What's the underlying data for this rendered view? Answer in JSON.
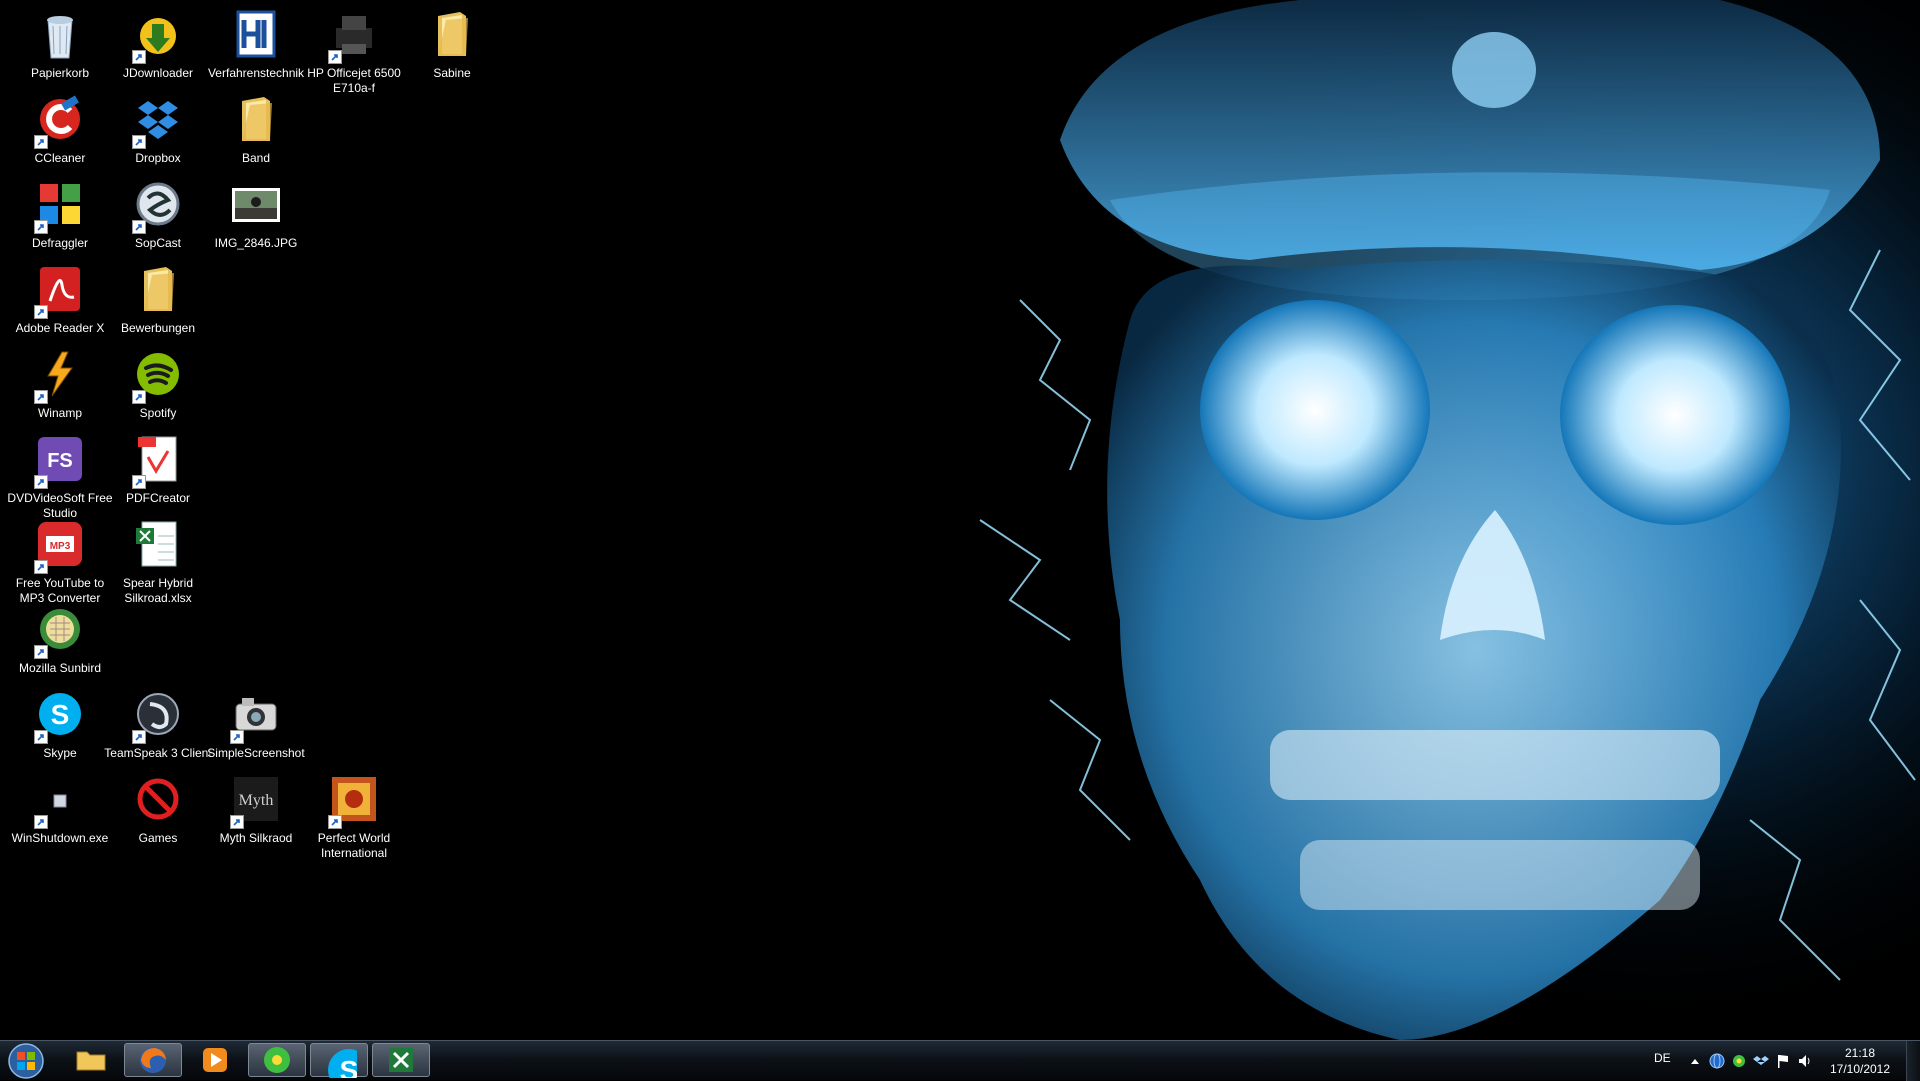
{
  "desktop": {
    "icons": [
      {
        "label": "Papierkorb",
        "icon": "recycle-bin-icon",
        "shortcut": false
      },
      {
        "label": "JDownloader",
        "icon": "jdownloader-icon",
        "shortcut": true
      },
      {
        "label": "Verfahrenstechnik",
        "icon": "verfahrenstechnik-icon",
        "shortcut": false
      },
      {
        "label": "HP Officejet 6500 E710a-f",
        "icon": "printer-icon",
        "shortcut": true
      },
      {
        "label": "Sabine",
        "icon": "folder-icon",
        "shortcut": false
      },
      {
        "label": "CCleaner",
        "icon": "ccleaner-icon",
        "shortcut": true
      },
      {
        "label": "Dropbox",
        "icon": "dropbox-icon",
        "shortcut": true
      },
      {
        "label": "Band",
        "icon": "folder-icon",
        "shortcut": false
      },
      {
        "label": "Defraggler",
        "icon": "defraggler-icon",
        "shortcut": true
      },
      {
        "label": "SopCast",
        "icon": "sopcast-icon",
        "shortcut": true
      },
      {
        "label": "IMG_2846.JPG",
        "icon": "photo-icon",
        "shortcut": false
      },
      {
        "label": "Adobe Reader X",
        "icon": "adobe-reader-icon",
        "shortcut": true
      },
      {
        "label": "Bewerbungen",
        "icon": "folder-icon",
        "shortcut": false
      },
      {
        "label": "Winamp",
        "icon": "winamp-icon",
        "shortcut": true
      },
      {
        "label": "Spotify",
        "icon": "spotify-icon",
        "shortcut": true
      },
      {
        "label": "DVDVideoSoft Free Studio",
        "icon": "dvdvideosoft-icon",
        "shortcut": true
      },
      {
        "label": "PDFCreator",
        "icon": "pdfcreator-icon",
        "shortcut": true
      },
      {
        "label": "Free YouTube to MP3 Converter",
        "icon": "mp3-converter-icon",
        "shortcut": true
      },
      {
        "label": "Spear Hybrid Silkroad.xlsx",
        "icon": "excel-file-icon",
        "shortcut": false
      },
      {
        "label": "Mozilla Sunbird",
        "icon": "sunbird-icon",
        "shortcut": true
      },
      {
        "label": "Skype",
        "icon": "skype-icon",
        "shortcut": true
      },
      {
        "label": "TeamSpeak 3 Client",
        "icon": "teamspeak-icon",
        "shortcut": true
      },
      {
        "label": "SimpleScreenshot",
        "icon": "camera-icon",
        "shortcut": true
      },
      {
        "label": "WinShutdown.exe",
        "icon": "exe-icon",
        "shortcut": true
      },
      {
        "label": "Games",
        "icon": "games-icon",
        "shortcut": false
      },
      {
        "label": "Myth Silkraod",
        "icon": "myth-silkroad-icon",
        "shortcut": true
      },
      {
        "label": "Perfect World International",
        "icon": "perfect-world-icon",
        "shortcut": true
      }
    ]
  },
  "taskbar": {
    "start": {
      "icon": "windows-start-icon"
    },
    "pinned": [
      {
        "name": "Windows Explorer",
        "icon": "explorer-folder-icon",
        "open": false
      },
      {
        "name": "Firefox",
        "icon": "firefox-icon",
        "open": true
      },
      {
        "name": "Windows Media Player",
        "icon": "media-player-icon",
        "open": false
      },
      {
        "name": "ICQ",
        "icon": "icq-icon",
        "open": true
      },
      {
        "name": "Skype",
        "icon": "skype-icon",
        "open": true
      },
      {
        "name": "Excel",
        "icon": "excel-icon",
        "open": true
      }
    ],
    "tray": {
      "language": "DE",
      "icons": [
        "show-hidden-icon",
        "network-globe-icon",
        "icq-tray-icon",
        "dropbox-tray-icon",
        "action-center-flag-icon",
        "volume-icon"
      ],
      "time": "21:18",
      "date": "17/10/2012"
    }
  },
  "colors": {
    "desktop_bg": "#000000",
    "wallpaper_glow": "#34b8ff",
    "label_text": "#ffffff"
  }
}
